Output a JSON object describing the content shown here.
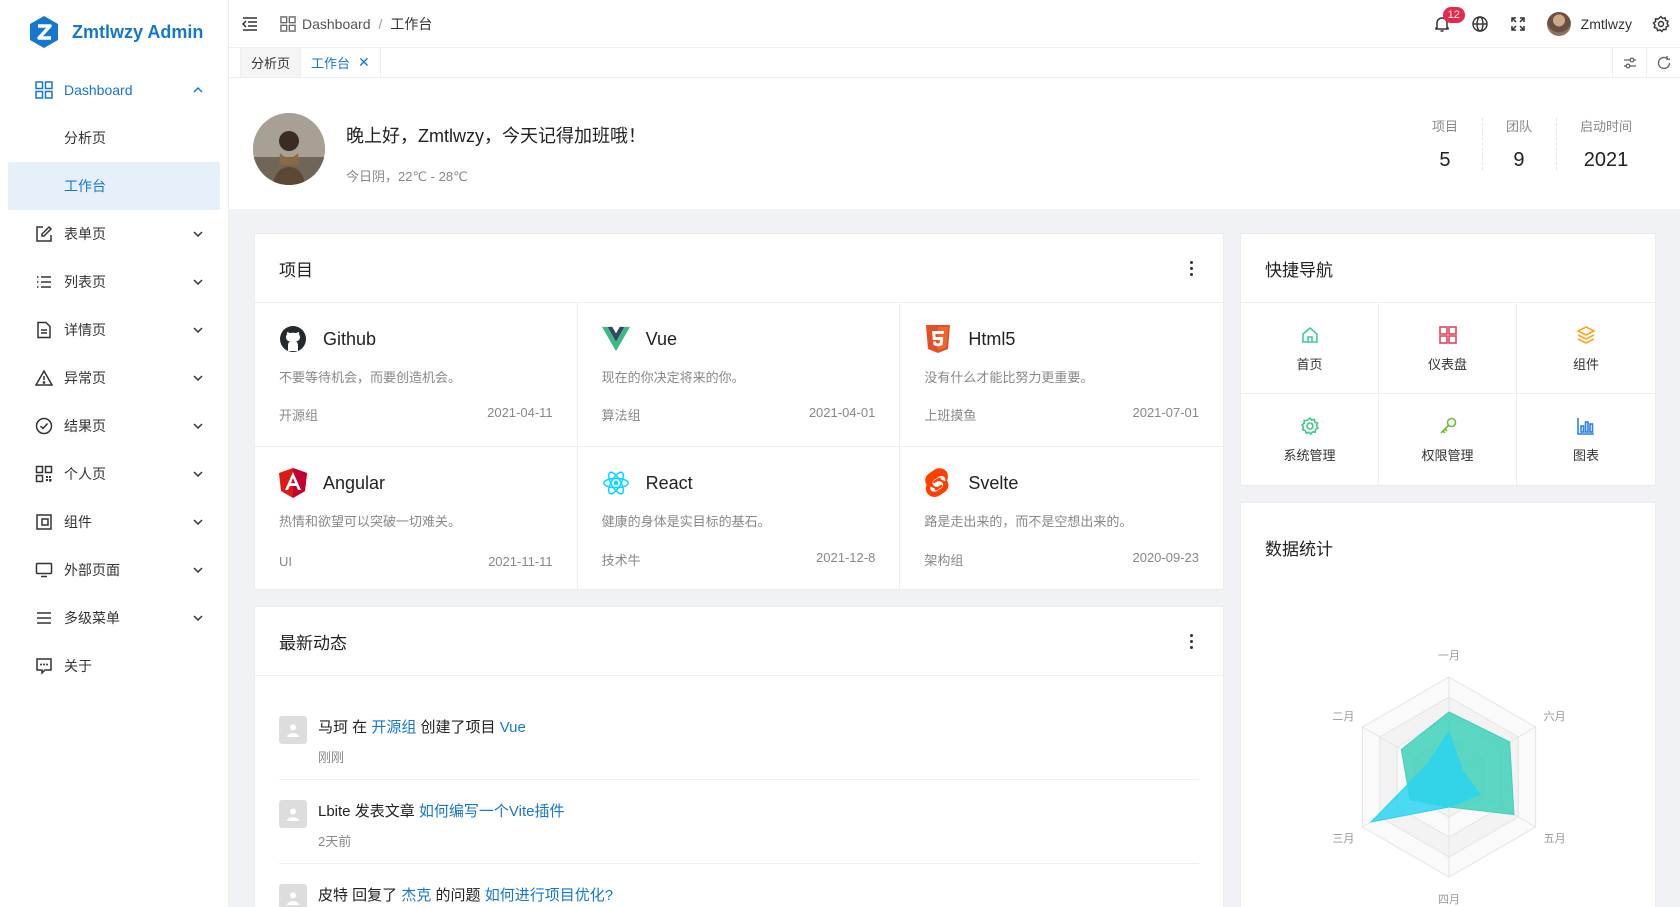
{
  "app": {
    "title": "Zmtlwzy Admin",
    "brand_color": "#1677cc"
  },
  "sidebar": {
    "dashboard": {
      "label": "Dashboard",
      "children": [
        {
          "label": "分析页"
        },
        {
          "label": "工作台"
        }
      ]
    },
    "items": [
      {
        "label": "表单页",
        "icon": "edit-icon"
      },
      {
        "label": "列表页",
        "icon": "list-icon"
      },
      {
        "label": "详情页",
        "icon": "file-icon"
      },
      {
        "label": "异常页",
        "icon": "warning-icon"
      },
      {
        "label": "结果页",
        "icon": "check-circle-icon"
      },
      {
        "label": "个人页",
        "icon": "qrcode-icon"
      },
      {
        "label": "组件",
        "icon": "component-icon"
      },
      {
        "label": "外部页面",
        "icon": "monitor-icon"
      },
      {
        "label": "多级菜单",
        "icon": "menu-icon"
      },
      {
        "label": "关于",
        "icon": "message-icon"
      }
    ]
  },
  "header": {
    "breadcrumb": [
      "Dashboard",
      "工作台"
    ],
    "notifications": "12",
    "username": "Zmtlwzy"
  },
  "tabs": [
    {
      "label": "分析页"
    },
    {
      "label": "工作台",
      "close": "✕"
    }
  ],
  "welcome": {
    "greeting": "晚上好，Zmtlwzy，今天记得加班哦！",
    "weather": "今日阴，22℃ - 28℃",
    "stats": [
      {
        "label": "项目",
        "value": "5"
      },
      {
        "label": "团队",
        "value": "9"
      },
      {
        "label": "启动时间",
        "value": "2021"
      }
    ]
  },
  "projects": {
    "title": "项目",
    "items": [
      {
        "name": "Github",
        "desc": "不要等待机会，而要创造机会。",
        "group": "开源组",
        "date": "2021-04-11",
        "icon": "github-icon",
        "color": "#24292e"
      },
      {
        "name": "Vue",
        "desc": "现在的你决定将来的你。",
        "group": "算法组",
        "date": "2021-04-01",
        "icon": "vue-icon",
        "color": "#3fb984"
      },
      {
        "name": "Html5",
        "desc": "没有什么才能比努力更重要。",
        "group": "上班摸鱼",
        "date": "2021-07-01",
        "icon": "html5-icon",
        "color": "#e34f26"
      },
      {
        "name": "Angular",
        "desc": "热情和欲望可以突破一切难关。",
        "group": "UI",
        "date": "2021-11-11",
        "icon": "angular-icon",
        "color": "#dd1b16"
      },
      {
        "name": "React",
        "desc": "健康的身体是实目标的基石。",
        "group": "技术牛",
        "date": "2021-12-8",
        "icon": "react-icon",
        "color": "#00d8ff"
      },
      {
        "name": "Svelte",
        "desc": "路是走出来的，而不是空想出来的。",
        "group": "架构组",
        "date": "2020-09-23",
        "icon": "svelte-icon",
        "color": "#ff3e00"
      }
    ]
  },
  "activity": {
    "title": "最新动态",
    "items": [
      {
        "parts": [
          "马珂 在 ",
          "开源组",
          " 创建了项目 ",
          "Vue"
        ],
        "time": "刚刚"
      },
      {
        "parts": [
          "Lbite 发表文章 ",
          "如何编写一个Vite插件",
          "",
          ""
        ],
        "time": "2天前"
      },
      {
        "parts": [
          "皮特 回复了 ",
          "杰克",
          " 的问题 ",
          "如何进行项目优化?"
        ],
        "time": ""
      }
    ]
  },
  "quicknav": {
    "title": "快捷导航",
    "items": [
      {
        "label": "首页",
        "icon": "home-icon",
        "color": "#3fc9a5"
      },
      {
        "label": "仪表盘",
        "icon": "dashboard-icon",
        "color": "#e0485a"
      },
      {
        "label": "组件",
        "icon": "layers-icon",
        "color": "#f5a623"
      },
      {
        "label": "系统管理",
        "icon": "gear-icon",
        "color": "#3fc98a"
      },
      {
        "label": "权限管理",
        "icon": "key-icon",
        "color": "#6cbf3a"
      },
      {
        "label": "图表",
        "icon": "bar-chart-icon",
        "color": "#2f7fe6"
      }
    ]
  },
  "stats_chart": {
    "title": "数据统计",
    "chart_data": {
      "type": "radar",
      "axes": [
        "一月",
        "六月",
        "五月",
        "四月",
        "三月",
        "二月"
      ],
      "max": 100,
      "series": [
        {
          "values": [
            65,
            70,
            75,
            30,
            45,
            55
          ],
          "color": "#3fd0b8"
        },
        {
          "values": [
            45,
            15,
            35,
            30,
            90,
            25
          ],
          "color": "#2bd3ee"
        }
      ]
    }
  }
}
